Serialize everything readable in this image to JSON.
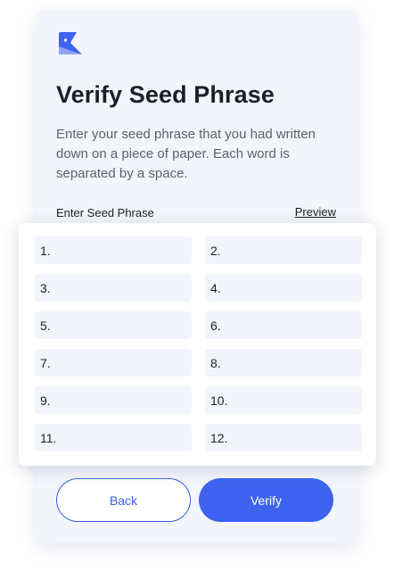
{
  "header": {
    "title": "Verify Seed Phrase",
    "description": "Enter your seed phrase that you had written down on a piece of paper. Each word is separated by a space."
  },
  "seed_input": {
    "label": "Enter Seed Phrase",
    "preview_link": "Preview",
    "slots": [
      "1.",
      "2.",
      "3.",
      "4.",
      "5.",
      "6.",
      "7.",
      "8.",
      "9.",
      "10.",
      "11.",
      "12."
    ]
  },
  "actions": {
    "back_label": "Back",
    "verify_label": "Verify"
  },
  "icons": {
    "logo": "wallet-logo-icon"
  },
  "colors": {
    "accent": "#3f63f0",
    "card_background": "#f3f5fd",
    "input_background": "#f3f5fd",
    "logo_primary": "#3f63f0",
    "logo_secondary": "#8fa4f5"
  }
}
